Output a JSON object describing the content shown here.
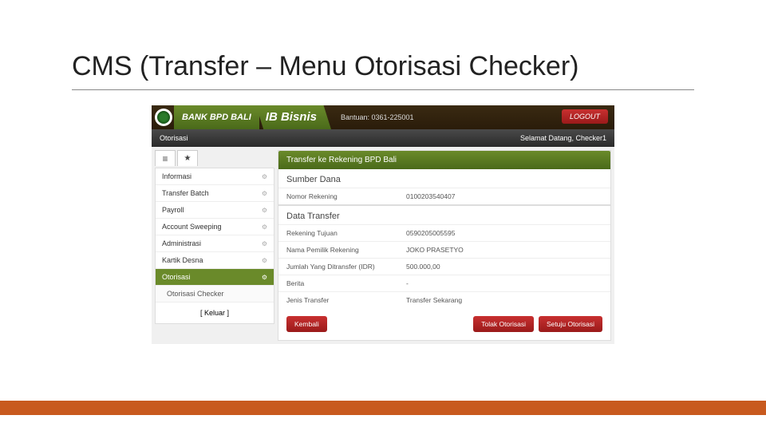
{
  "slide": {
    "title": "CMS (Transfer – Menu Otorisasi Checker)"
  },
  "header": {
    "bank_name": "BANK BPD BALI",
    "ib_bisnis": "IB Bisnis",
    "bantuan": "Bantuan: 0361-225001",
    "logout": "LOGOUT"
  },
  "menubar": {
    "left": "Otorisasi",
    "right": "Selamat Datang, Checker1"
  },
  "sidebar": {
    "items": [
      {
        "label": "Informasi"
      },
      {
        "label": "Transfer Batch"
      },
      {
        "label": "Payroll"
      },
      {
        "label": "Account Sweeping"
      },
      {
        "label": "Administrasi"
      },
      {
        "label": "Kartik Desna"
      },
      {
        "label": "Otorisasi",
        "active": true
      }
    ],
    "sub": "Otorisasi Checker",
    "logout": "[ Keluar ]"
  },
  "panel": {
    "title": "Transfer ke Rekening BPD Bali",
    "sumber": {
      "heading": "Sumber Dana",
      "rows": [
        {
          "label": "Nomor Rekening",
          "value": "0100203540407"
        }
      ]
    },
    "data": {
      "heading": "Data Transfer",
      "rows": [
        {
          "label": "Rekening Tujuan",
          "value": "0590205005595"
        },
        {
          "label": "Nama Pemilik Rekening",
          "value": "JOKO PRASETYO"
        },
        {
          "label": "Jumlah Yang Ditransfer (IDR)",
          "value": "500.000,00"
        },
        {
          "label": "Berita",
          "value": "-"
        },
        {
          "label": "Jenis Transfer",
          "value": "Transfer Sekarang"
        }
      ]
    },
    "actions": {
      "back": "Kembali",
      "reject": "Tolak Otorisasi",
      "approve": "Setuju Otorisasi"
    }
  }
}
